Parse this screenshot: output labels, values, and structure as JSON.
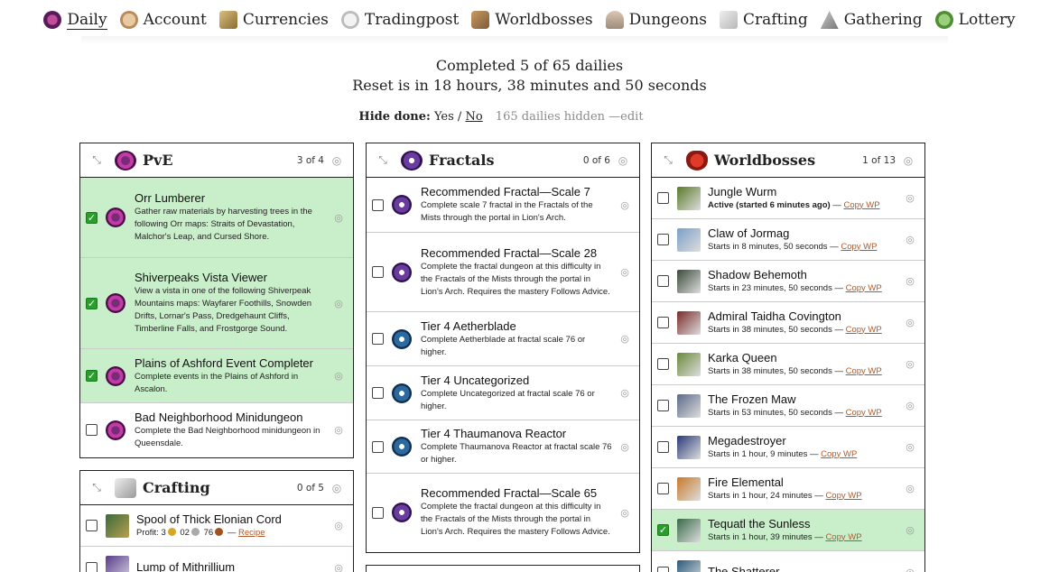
{
  "nav": [
    {
      "label": "Daily",
      "icon": "daily-icon",
      "active": true
    },
    {
      "label": "Account",
      "icon": "account-icon"
    },
    {
      "label": "Currencies",
      "icon": "currencies-icon"
    },
    {
      "label": "Tradingpost",
      "icon": "tradingpost-icon"
    },
    {
      "label": "Worldbosses",
      "icon": "worldbosses-icon"
    },
    {
      "label": "Dungeons",
      "icon": "dungeons-icon"
    },
    {
      "label": "Crafting",
      "icon": "crafting-icon"
    },
    {
      "label": "Gathering",
      "icon": "gathering-icon"
    },
    {
      "label": "Lottery",
      "icon": "lottery-icon"
    }
  ],
  "summary": {
    "completed": "Completed 5 of 65 dailies",
    "reset": "Reset is in 18 hours, 38 minutes and 50 seconds"
  },
  "hide": {
    "label": "Hide done:",
    "yes": "Yes",
    "sep": "/",
    "no": "No",
    "hidden": "165 dailies hidden",
    "edit": "—edit"
  },
  "pve": {
    "title": "PvE",
    "count": "3 of 4",
    "items": [
      {
        "title": "Orr Lumberer",
        "desc": "Gather raw materials by harvesting trees in the following Orr maps: Straits of Devastation, Malchor's Leap, and Cursed Shore.",
        "done": true
      },
      {
        "title": "Shiverpeaks Vista Viewer",
        "desc": "View a vista in one of the following Shiverpeak Mountains maps: Wayfarer Foothills, Snowden Drifts, Lornar's Pass, Dredgehaunt Cliffs, Timberline Falls, and Frostgorge Sound.",
        "done": true
      },
      {
        "title": "Plains of Ashford Event Completer",
        "desc": "Complete events in the Plains of Ashford in Ascalon.",
        "done": true
      },
      {
        "title": "Bad Neighborhood Minidungeon",
        "desc": "Complete the Bad Neighborhood minidungeon in Queensdale.",
        "done": false
      }
    ]
  },
  "crafting": {
    "title": "Crafting",
    "count": "0 of 5",
    "items": [
      {
        "title": "Spool of Thick Elonian Cord",
        "profit_label": "Profit:",
        "g": "3",
        "s": "02",
        "c": "76",
        "dash": "—",
        "link": "Recipe"
      },
      {
        "title": "Lump of Mithrillium"
      }
    ]
  },
  "fractals": {
    "title": "Fractals",
    "count": "0 of 6",
    "items": [
      {
        "title": "Recommended Fractal—Scale 7",
        "desc": "Complete scale 7 fractal in the Fractals of the Mists through the portal in Lion's Arch.",
        "icon": "fractal-icon"
      },
      {
        "title": "Recommended Fractal—Scale 28",
        "desc": "Complete the fractal dungeon at this difficulty in the Fractals of the Mists through the portal in Lion's Arch. Requires the mastery Follows Advice.",
        "icon": "fractal-icon"
      },
      {
        "title": "Tier 4 Aetherblade",
        "desc": "Complete Aetherblade at fractal scale 76 or higher.",
        "icon": "fractal-tier4-icon"
      },
      {
        "title": "Tier 4 Uncategorized",
        "desc": "Complete Uncategorized at fractal scale 76 or higher.",
        "icon": "fractal-tier4-icon"
      },
      {
        "title": "Tier 4 Thaumanova Reactor",
        "desc": "Complete Thaumanova Reactor at fractal scale 76 or higher.",
        "icon": "fractal-tier4-icon"
      },
      {
        "title": "Recommended Fractal—Scale 65",
        "desc": "Complete the fractal dungeon at this difficulty in the Fractals of the Mists through the portal in Lion's Arch. Requires the mastery Follows Advice.",
        "icon": "fractal-icon"
      }
    ]
  },
  "worldbosses": {
    "title": "Worldbosses",
    "count": "1 of 13",
    "copy_wp": "Copy WP",
    "items": [
      {
        "title": "Jungle Wurm",
        "status": "Active (started 6 minutes ago)",
        "active": true,
        "color": "#5a7a2a"
      },
      {
        "title": "Claw of Jormag",
        "status": "Starts in 8 minutes, 50 seconds",
        "color": "#7aa0c8"
      },
      {
        "title": "Shadow Behemoth",
        "status": "Starts in 23 minutes, 50 seconds",
        "color": "#3a4a3a"
      },
      {
        "title": "Admiral Taidha Covington",
        "status": "Starts in 38 minutes, 50 seconds",
        "color": "#7a2a2a"
      },
      {
        "title": "Karka Queen",
        "status": "Starts in 38 minutes, 50 seconds",
        "color": "#6a8a3a"
      },
      {
        "title": "The Frozen Maw",
        "status": "Starts in 53 minutes, 50 seconds",
        "color": "#5a6a8a"
      },
      {
        "title": "Megadestroyer",
        "status": "Starts in 1 hour, 9 minutes",
        "color": "#2a3a7a"
      },
      {
        "title": "Fire Elemental",
        "status": "Starts in 1 hour, 24 minutes",
        "color": "#c87a2a"
      },
      {
        "title": "Tequatl the Sunless",
        "status": "Starts in 1 hour, 39 minutes",
        "done": true,
        "color": "#3a6a4a"
      },
      {
        "title": "The Shatterer",
        "color": "#2a5a7a"
      }
    ]
  }
}
